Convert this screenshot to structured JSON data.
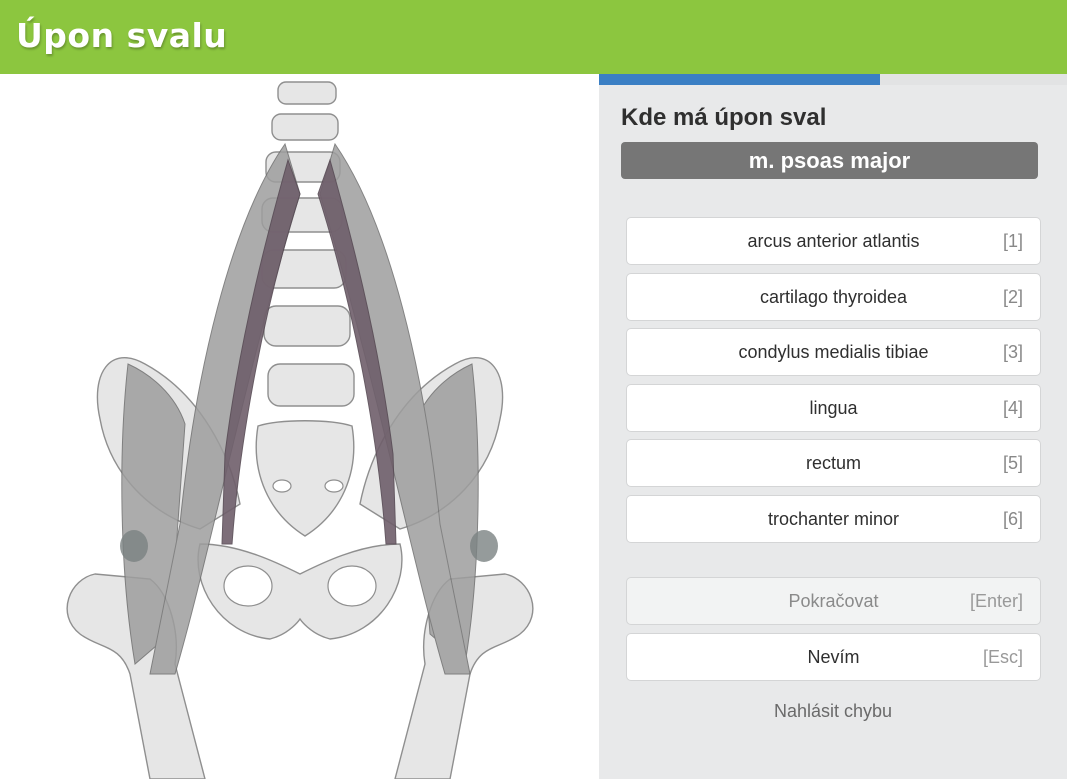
{
  "header": {
    "title": "Úpon svalu",
    "background_color": "#8cc63f"
  },
  "progress": {
    "value": 0.6
  },
  "question": {
    "label": "Kde má úpon sval",
    "term": "m. psoas major"
  },
  "options": [
    {
      "label": "arcus anterior atlantis",
      "key": "[1]"
    },
    {
      "label": "cartilago thyroidea",
      "key": "[2]"
    },
    {
      "label": "condylus medialis tibiae",
      "key": "[3]"
    },
    {
      "label": "lingua",
      "key": "[4]"
    },
    {
      "label": "rectum",
      "key": "[5]"
    },
    {
      "label": "trochanter minor",
      "key": "[6]"
    }
  ],
  "actions": {
    "continue": {
      "label": "Pokračovat",
      "key": "[Enter]"
    },
    "dont_know": {
      "label": "Nevím",
      "key": "[Esc]"
    }
  },
  "report_link": "Nahlásit chybu",
  "colors": {
    "accent": "#3a7fc4",
    "muscle": "#7a6a76",
    "bone": "#e9e9e9"
  }
}
